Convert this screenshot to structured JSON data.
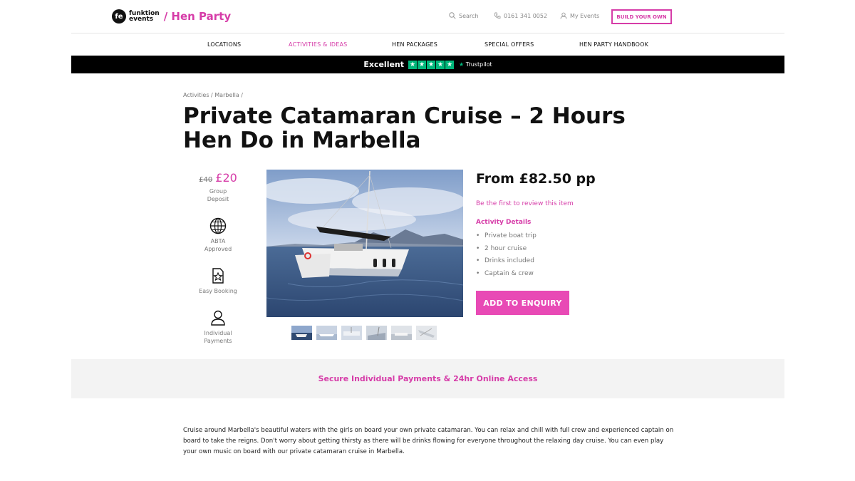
{
  "header": {
    "logo_mark": "fe",
    "logo_line1": "funktion",
    "logo_line2": "events",
    "section": "/ Hen Party",
    "search_label": "Search",
    "phone": "0161 341 0052",
    "my_events": "My Events",
    "build_label": "BUILD YOUR OWN"
  },
  "nav": {
    "items": [
      "LOCATIONS",
      "ACTIVITIES & IDEAS",
      "HEN PACKAGES",
      "SPECIAL OFFERS",
      "HEN PARTY HANDBOOK"
    ],
    "active_index": 1
  },
  "trustpilot": {
    "rating_label": "Excellent",
    "brand": "Trustpilot"
  },
  "breadcrumb": "Activities / Marbella /",
  "title": "Private Catamaran Cruise – 2 Hours Hen Do in Marbella",
  "perks": {
    "price_old": "£40",
    "price_new": "£20",
    "deposit_label": "Group Deposit",
    "items": [
      {
        "label": "ABTA Approved",
        "icon": "globe-icon"
      },
      {
        "label": "Easy Booking",
        "icon": "booking-star-icon"
      },
      {
        "label": "Individual Payments",
        "icon": "person-icon"
      }
    ]
  },
  "product": {
    "from_price": "From £82.50 pp",
    "review_link": "Be the first to review this item",
    "details_title": "Activity Details",
    "details": [
      "Private boat trip",
      "2 hour cruise",
      "Drinks included",
      "Captain & crew"
    ],
    "add_button": "ADD TO ENQUIRY"
  },
  "secure_banner": "Secure Individual Payments & 24hr Online Access",
  "description": "Cruise around Marbella's beautiful waters with the girls on board your own private catamaran. You can relax and chill with  full crew and experienced captain on board to take the reigns. Don't worry about getting thirsty as there will be drinks flowing for everyone throughout the relaxing day cruise. You can even play your own music on board with our private catamaran cruise in Marbella.",
  "colors": {
    "brand_pink": "#d63ca8",
    "button_pink": "#e84ab5",
    "trustpilot_green": "#00b67a"
  }
}
